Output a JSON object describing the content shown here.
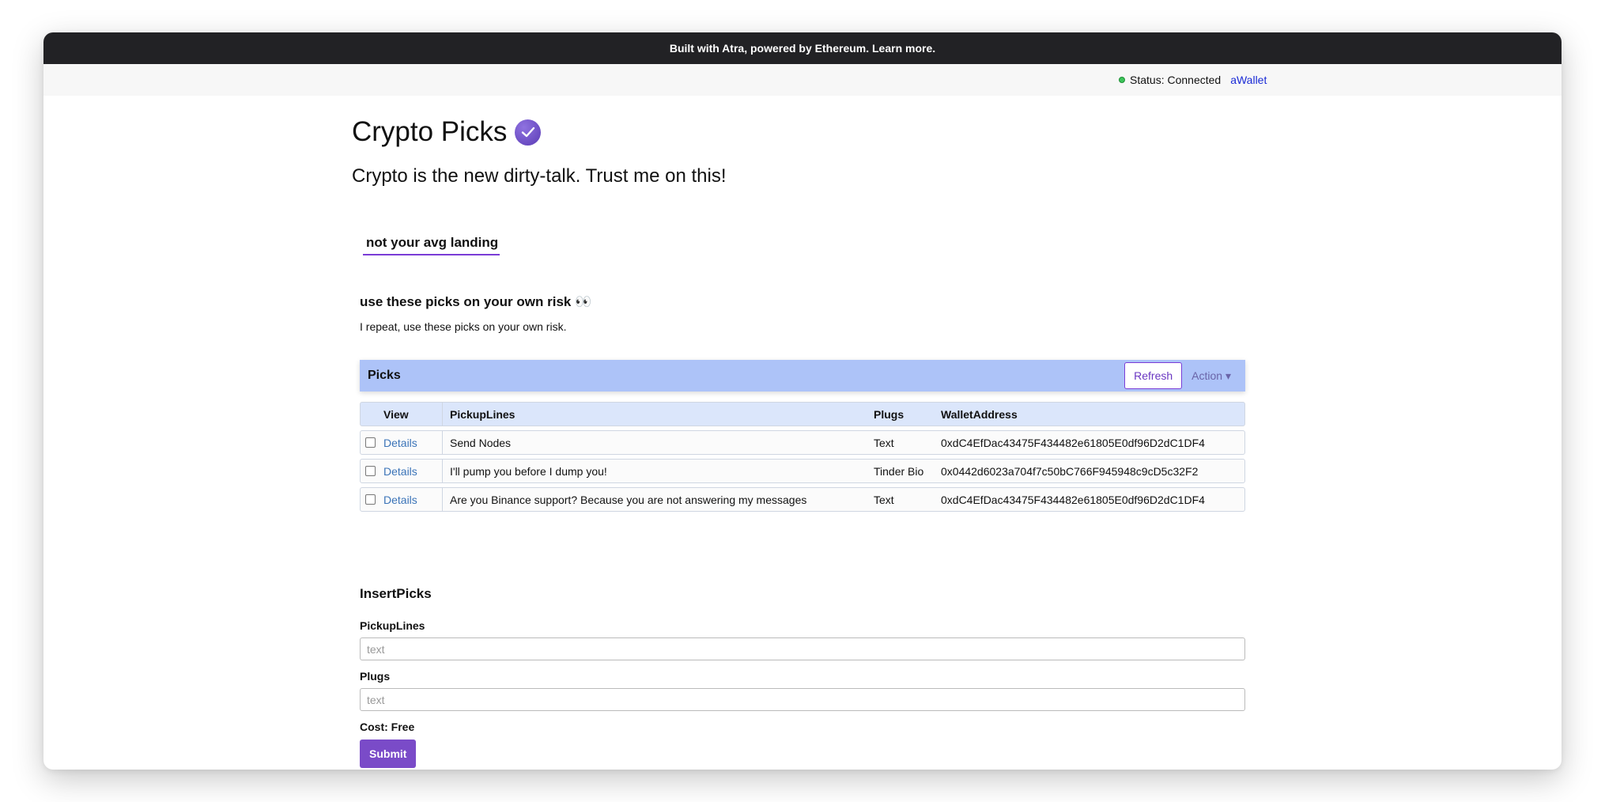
{
  "topbar": {
    "text": "Built with Atra, powered by Ethereum. Learn more."
  },
  "status": {
    "text": "Status: Connected",
    "wallet_link": "aWallet",
    "indicator_color": "#3cc45a"
  },
  "header": {
    "title": "Crypto Picks",
    "subtitle": "Crypto is the new dirty-talk. Trust me on this!",
    "landing": "not your avg landing",
    "verified_icon": "verified-check-icon"
  },
  "notice": {
    "heading": "use these picks on your own risk 👀",
    "text": "I repeat, use these picks on your own risk."
  },
  "picks": {
    "title": "Picks",
    "refresh_label": "Refresh",
    "action_label": "Action ▾",
    "columns": [
      "View",
      "PickupLines",
      "Plugs",
      "WalletAddress"
    ],
    "rows": [
      {
        "view": "Details",
        "line": "Send Nodes",
        "plug": "Text",
        "wallet": "0xdC4EfDac43475F434482e61805E0df96D2dC1DF4"
      },
      {
        "view": "Details",
        "line": "I'll pump you before I dump you!",
        "plug": "Tinder Bio",
        "wallet": "0x0442d6023a704f7c50bC766F945948c9cD5c32F2"
      },
      {
        "view": "Details",
        "line": "Are you Binance support? Because you are not answering my messages",
        "plug": "Text",
        "wallet": "0xdC4EfDac43475F434482e61805E0df96D2dC1DF4"
      }
    ]
  },
  "insert": {
    "title": "InsertPicks",
    "pickuplines_label": "PickupLines",
    "pickuplines_placeholder": "text",
    "plugs_label": "Plugs",
    "plugs_placeholder": "text",
    "cost": "Cost: Free",
    "submit_label": "Submit"
  },
  "colors": {
    "accent": "#7a4bc8",
    "header_bg": "#adc3f8",
    "link": "#3b74b8"
  }
}
